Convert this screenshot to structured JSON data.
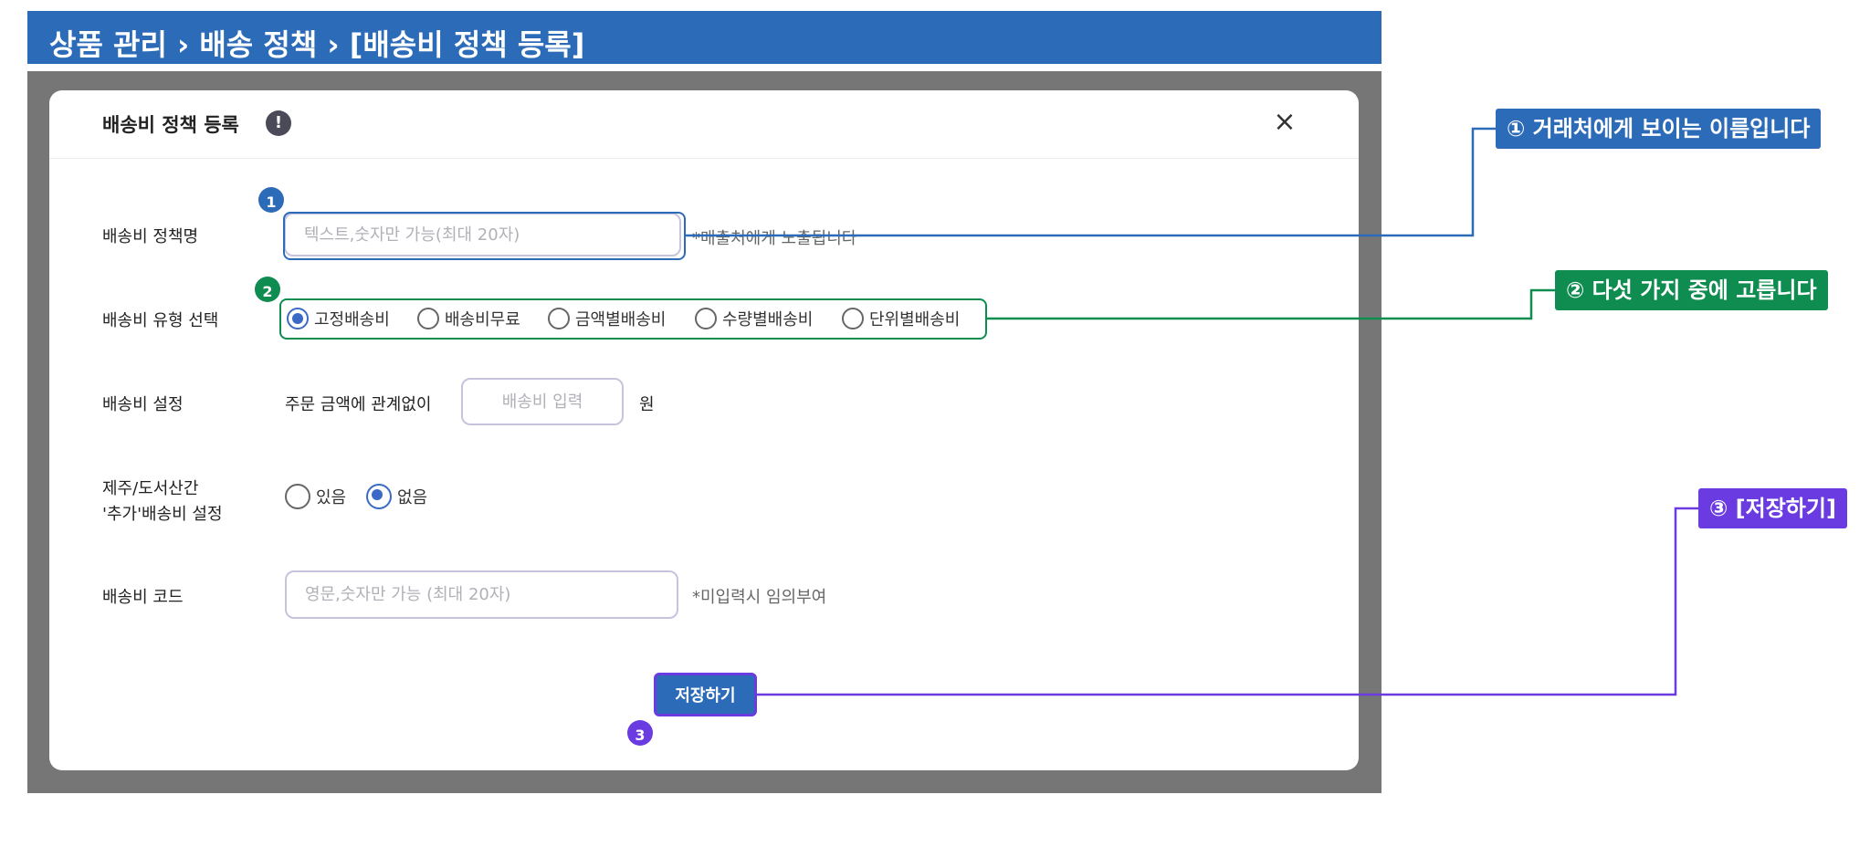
{
  "breadcrumb": {
    "text": "상품 관리 › 배송 정책 › [배송비 정책 등록]"
  },
  "modal": {
    "title": "배송비 정책 등록",
    "info_icon": "!",
    "close_icon": "×"
  },
  "form": {
    "policy_name": {
      "label": "배송비 정책명",
      "placeholder": "텍스트,숫자만 가능(최대 20자)",
      "value": "",
      "hint": "*매출처에게 노출됩니다"
    },
    "fee_type": {
      "label": "배송비 유형 선택",
      "options": [
        "고정배송비",
        "배송비무료",
        "금액별배송비",
        "수량별배송비",
        "단위별배송비"
      ],
      "selected": "고정배송비"
    },
    "fee_setting": {
      "label": "배송비 설정",
      "prefix": "주문 금액에 관계없이",
      "placeholder": "배송비 입력",
      "value": "",
      "suffix": "원"
    },
    "extra_fee": {
      "label_line1": "제주/도서산간",
      "label_line2": "'추가'배송비 설정",
      "options": [
        "있음",
        "없음"
      ],
      "selected": "없음"
    },
    "fee_code": {
      "label": "배송비 코드",
      "placeholder": "영문,숫자만 가능 (최대 20자)",
      "value": "",
      "hint": "*미입력시 임의부여"
    },
    "save_label": "저장하기"
  },
  "annotations": {
    "markers": [
      "1",
      "2",
      "3"
    ],
    "callouts": [
      {
        "text": "① 거래처에게 보이는 이름입니다",
        "color": "#2c6bb8"
      },
      {
        "text": "② 다섯 가지 중에 고릅니다",
        "color": "#0f8c4f"
      },
      {
        "text": "③ [저장하기]",
        "color": "#6a3be0"
      }
    ]
  },
  "colors": {
    "header_bg": "#2c6bb8",
    "overlay": "#767676",
    "radio_accent": "#3a6ac5",
    "annotation_blue": "#2c6bb8",
    "annotation_green": "#0f8c4f",
    "annotation_purple": "#6a3be0"
  }
}
